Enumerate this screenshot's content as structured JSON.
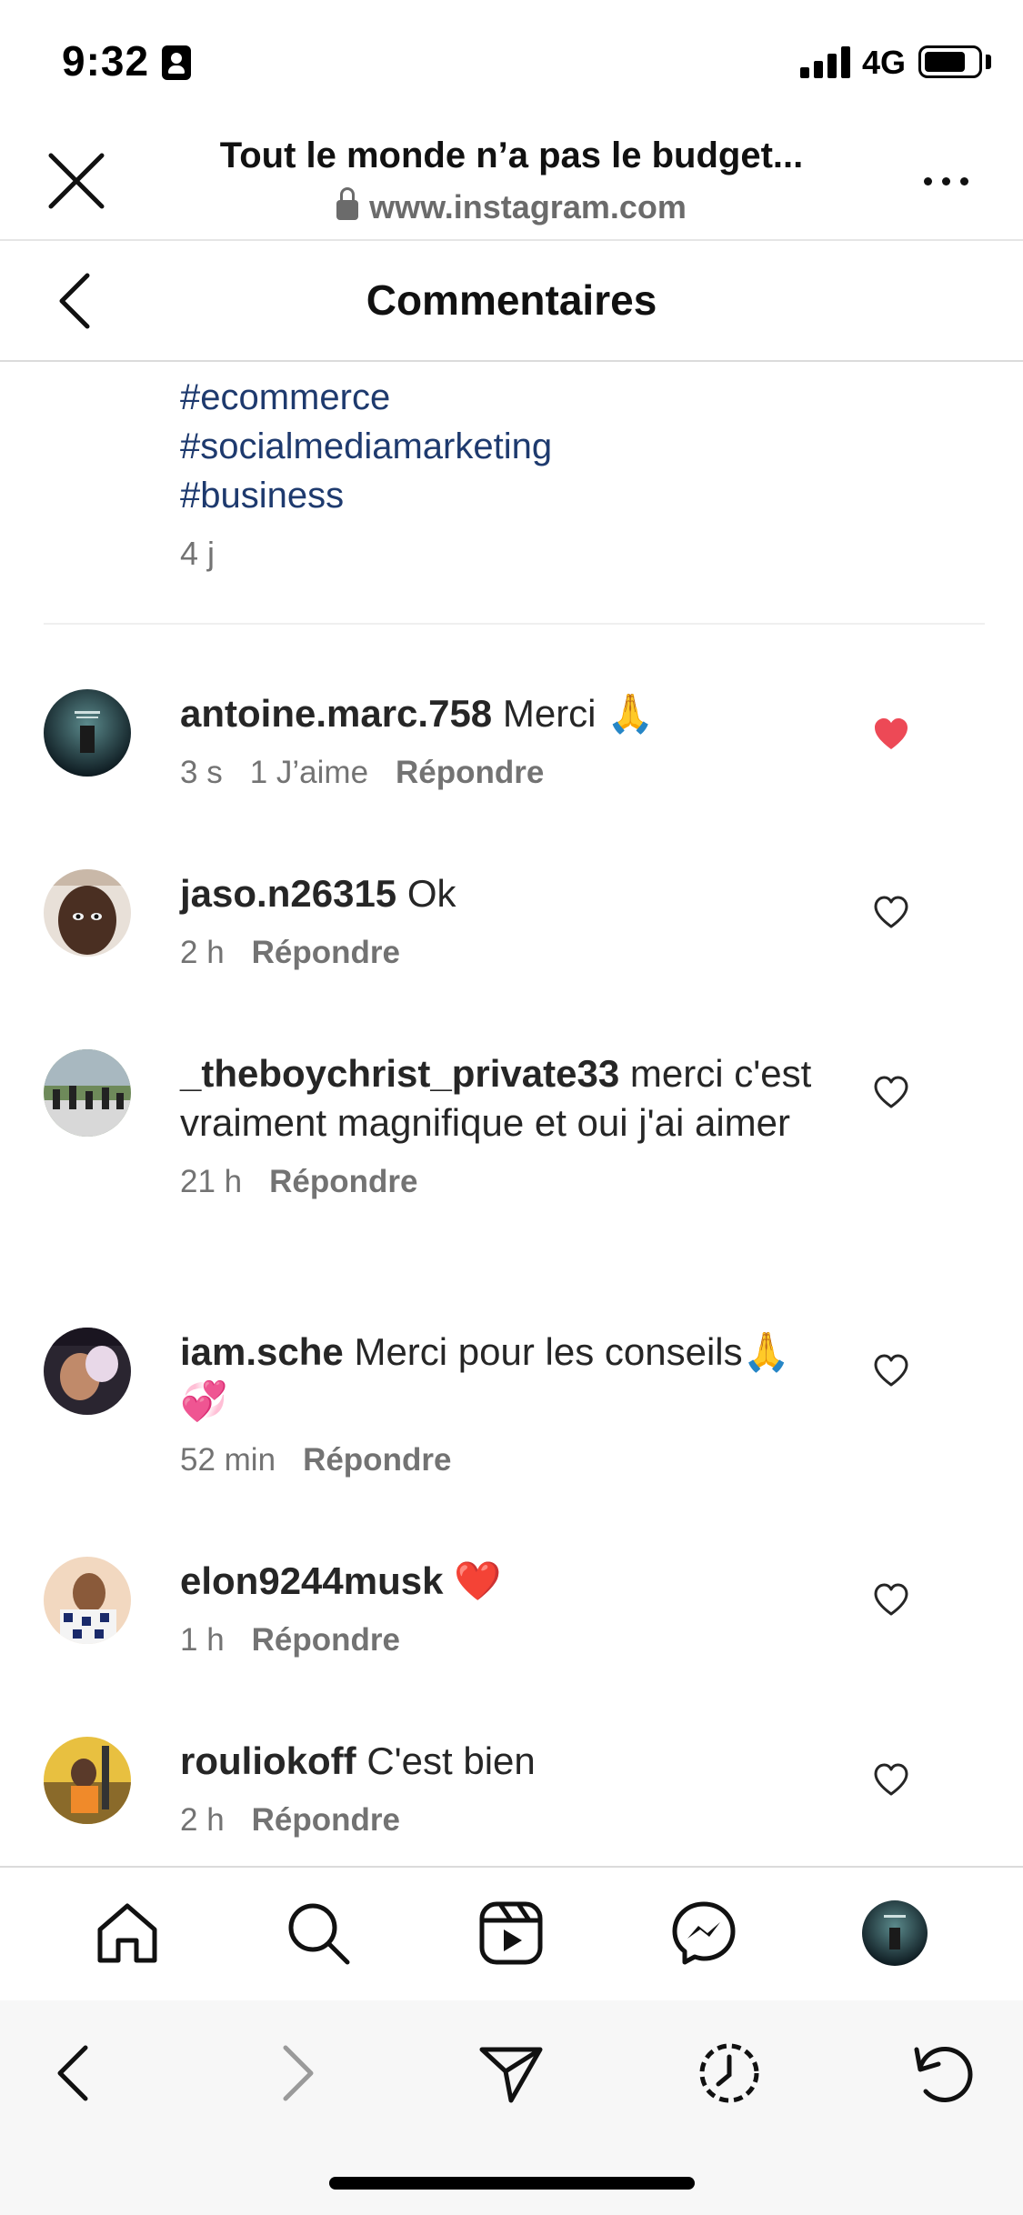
{
  "status_bar": {
    "time": "9:32",
    "network": "4G"
  },
  "browser": {
    "page_title": "Tout le monde n’a pas le budget...",
    "url": "www.instagram.com"
  },
  "header": {
    "title": "Commentaires"
  },
  "caption": {
    "hashtags": [
      "#ecommerce",
      "#socialmediamarketing",
      "#business"
    ],
    "time": "4 j"
  },
  "comments": [
    {
      "username": "antoine.marc.758",
      "text": "Merci 🙏",
      "time": "3 s",
      "likes": "1 J’aime",
      "reply": "Répondre",
      "liked": true
    },
    {
      "username": "jaso.n26315",
      "text": "Ok",
      "time": "2 h",
      "reply": "Répondre",
      "liked": false
    },
    {
      "username": "_theboychrist_private33",
      "text": "merci c'est vraiment magnifique et oui j'ai aimer",
      "time": "21 h",
      "reply": "Répondre",
      "liked": false
    },
    {
      "username": "iam.sche",
      "text": "Merci pour les conseils🙏💞",
      "time": "52 min",
      "reply": "Répondre",
      "liked": false
    },
    {
      "username": "elon9244musk",
      "text": "❤️",
      "time": "1 h",
      "reply": "Répondre",
      "liked": false
    },
    {
      "username": "rouliokoff",
      "text": "C'est bien",
      "time": "2 h",
      "reply": "Répondre",
      "liked": false
    }
  ],
  "colors": {
    "liked_heart": "#ed4956",
    "hashtag": "#1e3a6e",
    "meta": "#737373"
  },
  "ig_nav": [
    "home-icon",
    "search-icon",
    "reels-icon",
    "messenger-icon",
    "profile-avatar"
  ],
  "browser_toolbar": [
    "back-icon",
    "forward-icon",
    "share-icon",
    "history-icon",
    "reload-icon"
  ]
}
